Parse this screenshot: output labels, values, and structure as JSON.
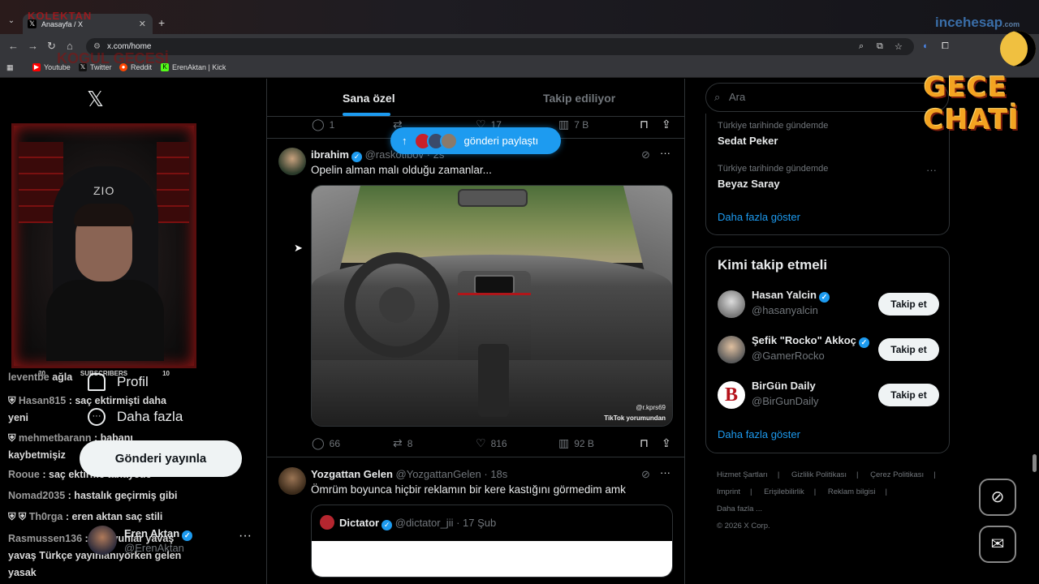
{
  "browser": {
    "tab_title": "Anasayfa / X",
    "url": "x.com/home",
    "bookmarks": [
      {
        "label": "Youtube",
        "color": "#ff0000"
      },
      {
        "label": "Twitter",
        "color": "#000000"
      },
      {
        "label": "Reddit",
        "color": "#ff4500"
      },
      {
        "label": "ErenAktan | Kick",
        "color": "#53fc18"
      }
    ]
  },
  "overlay": {
    "stream_brand_top": "KOLEKTAN",
    "stream_brand": "KOGUL GECESİ",
    "site_watermark": "incehesap",
    "site_watermark_tld": ".com",
    "night_brand_1": "GECE",
    "night_brand_2": "CHATİ",
    "subs_left": "30",
    "subs_label": "SUBSCRIBERS",
    "subs_right": "10",
    "chair_logo": "ZIO"
  },
  "nav": {
    "profile": "Profil",
    "more": "Daha fazla",
    "post_button": "Gönderi yayınla",
    "account_name": "Eren Aktan",
    "account_handle": "@ErenAktan"
  },
  "chat": [
    {
      "user": "leventbe",
      "msg": " ağla"
    },
    {
      "user": "Hasan815",
      "msg": ": saç ektirmişti daha yeni"
    },
    {
      "user": "mehmetbarann",
      "msg": ": babanı kaybetmişiz"
    },
    {
      "user": "Rooue",
      "msg": ": saç ektirme tanayede"
    },
    {
      "user": "Nomad2035",
      "msg": ": hastalık geçirmiş gibi"
    },
    {
      "user": "Th0rga",
      "msg": ": eren aktan saç stili"
    },
    {
      "user": "Rasmussen136",
      "msg": ": bu oyunlar yavaş yavaş Türkçe yayınlanıyorken gelen yasak"
    }
  ],
  "feed": {
    "tab_for_you": "Sana özel",
    "tab_following": "Takip ediliyor",
    "new_posts_pill": "gönderi paylaştı",
    "prev_actions": {
      "replies": "1",
      "likes": "17",
      "views": "7 B"
    },
    "post1": {
      "name": "ibrahim",
      "handle": "@raskotibov",
      "time": "· 2s",
      "text": "Opelin alman malı olduğu zamanlar...",
      "media_watermark_user": "@r.kprs69",
      "media_watermark": "TikTok yorumundan",
      "replies": "66",
      "reposts": "8",
      "likes": "816",
      "views": "92 B"
    },
    "post2": {
      "name": "Yozgattan Gelen",
      "handle": "@YozgattanGelen",
      "time": "· 18s",
      "text": "Ömrüm boyunca hiçbir reklamın bir kere kastığını görmedim amk",
      "quote_name": "Dictator",
      "quote_handle": "@dictator_jii",
      "quote_time": "· 17 Şub"
    }
  },
  "sidebar": {
    "search_placeholder": "Ara",
    "trends": [
      {
        "context": "Türkiye tarihinde gündemde",
        "name": "Sedat Peker"
      },
      {
        "context": "Türkiye tarihinde gündemde",
        "name": "Beyaz Saray"
      }
    ],
    "show_more": "Daha fazla göster",
    "who_to_follow_title": "Kimi takip etmeli",
    "follow_button": "Takip et",
    "suggestions": [
      {
        "name": "Hasan Yalcin",
        "handle": "@hasanyalcin"
      },
      {
        "name": "Şefik \"Rocko\" Akkoç",
        "handle": "@GamerRocko"
      },
      {
        "name": "BirGün Daily",
        "handle": "@BirGunDaily"
      }
    ],
    "footer": [
      "Hizmet Şartları",
      "|",
      "Gizlilik Politikası",
      "|",
      "Çerez Politikası",
      "|",
      "Imprint",
      "|",
      "Erişilebilirlik",
      "|",
      "Reklam bilgisi",
      "|",
      "Daha fazla ...",
      "© 2026 X Corp."
    ]
  },
  "colors": {
    "accent": "#1d9bf0",
    "background": "#000000",
    "border": "#2f3336",
    "muted": "#71767b"
  }
}
